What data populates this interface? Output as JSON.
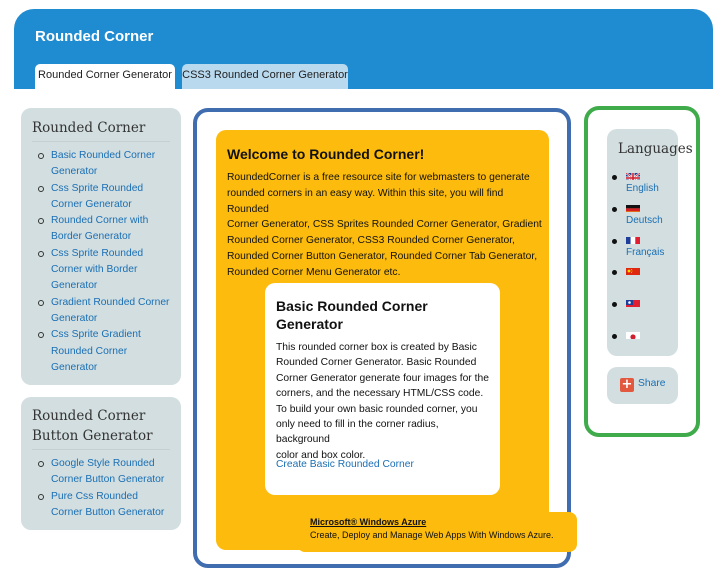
{
  "header": {
    "title": "Rounded Corner",
    "tabs": [
      "Rounded Corner Generator",
      "CSS3 Rounded Corner Generator"
    ]
  },
  "sidebar_generators": {
    "title": "Rounded Corner",
    "items": [
      [
        "Basic Rounded Corner",
        "Generator"
      ],
      [
        "Css Sprite Rounded",
        "Corner Generator"
      ],
      [
        "Rounded Corner with",
        "Border Generator"
      ],
      [
        "Css Sprite Rounded",
        "Corner with Border",
        "Generator"
      ],
      [
        "Gradient Rounded Corner",
        "Generator"
      ],
      [
        "Css Sprite Gradient",
        "Rounded Corner",
        "Generator"
      ]
    ]
  },
  "sidebar_buttons": {
    "title": [
      "Rounded Corner",
      "Button Generator"
    ],
    "items": [
      [
        "Google Style Rounded",
        "Corner Button Generator"
      ],
      [
        "Pure Css Rounded",
        "Corner Button Generator"
      ]
    ]
  },
  "welcome": {
    "title": "Welcome to Rounded Corner!",
    "lines": [
      "RoundedCorner is a free resource site for webmasters to generate",
      "rounded corners in an easy way. Within this site, you will find Rounded",
      "Corner Generator, CSS Sprites Rounded Corner Generator, Gradient",
      "Rounded Corner Generator, CSS3 Rounded Corner Generator,",
      "Rounded Corner Button Generator, Rounded Corner Tab Generator,",
      "Rounded Corner Menu Generator etc."
    ]
  },
  "basic": {
    "title": [
      "Basic Rounded Corner",
      "Generator"
    ],
    "lines": [
      "This rounded corner box is created by Basic",
      "Rounded Corner Generator. Basic Rounded",
      "Corner Generator generate four images for the",
      "corners, and the necessary HTML/CSS code.",
      "To build your own basic rounded corner, you",
      "only need to fill in the corner radius, background",
      "color and box color."
    ],
    "link": "Create Basic Rounded Corner"
  },
  "ad": {
    "title": "Microsoft® Windows Azure",
    "text": "Create, Deploy and Manage Web Apps With Windows Azure."
  },
  "languages": {
    "title": "Languages",
    "items": [
      {
        "name": "English",
        "flag": "uk-flag-icon"
      },
      {
        "name": "Deutsch",
        "flag": "de-flag-icon"
      },
      {
        "name": "Français",
        "flag": "fr-flag-icon"
      },
      {
        "name": "",
        "flag": "cn-flag-icon"
      },
      {
        "name": "",
        "flag": "tw-flag-icon"
      },
      {
        "name": "",
        "flag": "jp-flag-icon"
      }
    ]
  },
  "share": {
    "label": "Share",
    "icon": "plus-icon"
  },
  "colors": {
    "header": "#1f8bd0",
    "content_box": "#fcbb0d",
    "sidebar_box": "#d2dedf",
    "main_border": "#3f6db0",
    "language_border": "#3fab4a",
    "link": "#1a6fb5"
  }
}
